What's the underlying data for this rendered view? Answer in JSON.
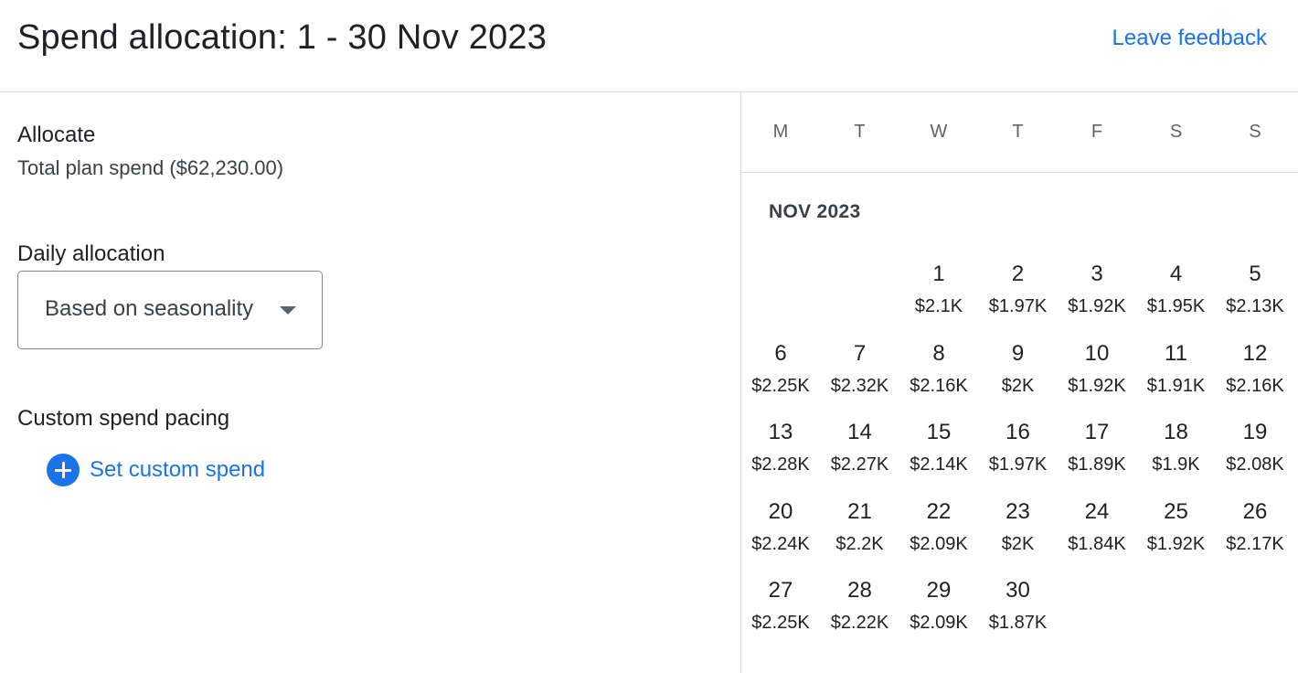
{
  "header": {
    "title": "Spend allocation: 1 - 30 Nov 2023",
    "feedback_label": "Leave feedback"
  },
  "allocate": {
    "title": "Allocate",
    "total_label": "Total plan spend ($62,230.00)"
  },
  "daily_allocation": {
    "title": "Daily allocation",
    "selected": "Based on seasonality"
  },
  "custom_pacing": {
    "title": "Custom spend pacing",
    "button_label": "Set custom spend",
    "icon": "add-circle-icon"
  },
  "calendar": {
    "weekdays": [
      "M",
      "T",
      "W",
      "T",
      "F",
      "S",
      "S"
    ],
    "month_label": "NOV 2023",
    "first_weekday_index": 2,
    "days": [
      {
        "day": "1",
        "spend": "$2.1K"
      },
      {
        "day": "2",
        "spend": "$1.97K"
      },
      {
        "day": "3",
        "spend": "$1.92K"
      },
      {
        "day": "4",
        "spend": "$1.95K"
      },
      {
        "day": "5",
        "spend": "$2.13K"
      },
      {
        "day": "6",
        "spend": "$2.25K"
      },
      {
        "day": "7",
        "spend": "$2.32K"
      },
      {
        "day": "8",
        "spend": "$2.16K"
      },
      {
        "day": "9",
        "spend": "$2K"
      },
      {
        "day": "10",
        "spend": "$1.92K"
      },
      {
        "day": "11",
        "spend": "$1.91K"
      },
      {
        "day": "12",
        "spend": "$2.16K"
      },
      {
        "day": "13",
        "spend": "$2.28K"
      },
      {
        "day": "14",
        "spend": "$2.27K"
      },
      {
        "day": "15",
        "spend": "$2.14K"
      },
      {
        "day": "16",
        "spend": "$1.97K"
      },
      {
        "day": "17",
        "spend": "$1.89K"
      },
      {
        "day": "18",
        "spend": "$1.9K"
      },
      {
        "day": "19",
        "spend": "$2.08K"
      },
      {
        "day": "20",
        "spend": "$2.24K"
      },
      {
        "day": "21",
        "spend": "$2.2K"
      },
      {
        "day": "22",
        "spend": "$2.09K"
      },
      {
        "day": "23",
        "spend": "$2K"
      },
      {
        "day": "24",
        "spend": "$1.84K"
      },
      {
        "day": "25",
        "spend": "$1.92K"
      },
      {
        "day": "26",
        "spend": "$2.17K"
      },
      {
        "day": "27",
        "spend": "$2.25K"
      },
      {
        "day": "28",
        "spend": "$2.22K"
      },
      {
        "day": "29",
        "spend": "$2.09K"
      },
      {
        "day": "30",
        "spend": "$1.87K"
      }
    ]
  },
  "colors": {
    "accent": "#1a73e8",
    "divider": "#dadce0",
    "text": "#202124"
  }
}
